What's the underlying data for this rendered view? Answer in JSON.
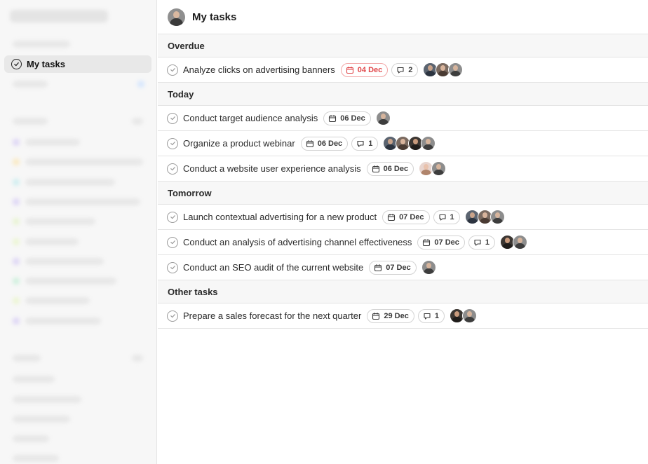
{
  "sidebar": {
    "active_item": {
      "label": "My tasks",
      "icon": "check-circle-icon"
    }
  },
  "header": {
    "title": "My tasks",
    "avatar": "user-avatar"
  },
  "colors": {
    "overdue_text": "#e0474a",
    "overdue_border": "#f2a6a6",
    "section_bg": "#f7f7f7",
    "border": "#e4e4e4"
  },
  "sections": [
    {
      "label": "Overdue",
      "tasks": [
        {
          "name": "Analyze clicks on advertising banners",
          "date": "04 Dec",
          "overdue": true,
          "comments": "2",
          "avatars": [
            "c1",
            "c2",
            "c3"
          ]
        }
      ]
    },
    {
      "label": "Today",
      "tasks": [
        {
          "name": "Conduct target audience analysis",
          "date": "06 Dec",
          "overdue": false,
          "comments": null,
          "avatars": [
            "c3"
          ]
        },
        {
          "name": "Organize a product webinar",
          "date": "06 Dec",
          "overdue": false,
          "comments": "1",
          "avatars": [
            "c1",
            "c2",
            "c4",
            "c3"
          ]
        },
        {
          "name": "Conduct a website user experience analysis",
          "date": "06 Dec",
          "overdue": false,
          "comments": null,
          "avatars": [
            "c5",
            "c3"
          ]
        }
      ]
    },
    {
      "label": "Tomorrow",
      "tasks": [
        {
          "name": "Launch contextual advertising for a new product",
          "date": "07 Dec",
          "overdue": false,
          "comments": "1",
          "avatars": [
            "c1",
            "c2",
            "c3"
          ]
        },
        {
          "name": "Conduct an analysis of advertising channel effectiveness",
          "date": "07 Dec",
          "overdue": false,
          "comments": "1",
          "avatars": [
            "c4",
            "c3"
          ]
        },
        {
          "name": "Conduct an SEO audit of the current website",
          "date": "07 Dec",
          "overdue": false,
          "comments": null,
          "avatars": [
            "c3"
          ]
        }
      ]
    },
    {
      "label": "Other tasks",
      "tasks": [
        {
          "name": "Prepare a sales forecast for the next quarter",
          "date": "29 Dec",
          "overdue": false,
          "comments": "1",
          "avatars": [
            "c4",
            "c3"
          ]
        }
      ]
    }
  ]
}
